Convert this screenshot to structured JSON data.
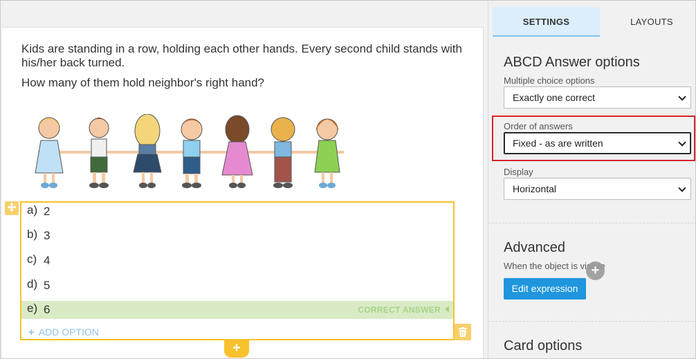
{
  "question": {
    "line1": "Kids are standing in a row, holding each other hands. Every second child stands with his/her back turned.",
    "line2": "How many of them hold neighbor's right hand?"
  },
  "answers": {
    "options": [
      {
        "letter": "a)",
        "value": "2"
      },
      {
        "letter": "b)",
        "value": "3"
      },
      {
        "letter": "c)",
        "value": "4"
      },
      {
        "letter": "d)",
        "value": "5"
      },
      {
        "letter": "e)",
        "value": "6"
      }
    ],
    "correct_label": "CORRECT ANSWER",
    "add_option": "ADD OPTION"
  },
  "tabs": {
    "settings": "SETTINGS",
    "layouts": "LAYOUTS"
  },
  "abcd": {
    "title": "ABCD Answer options",
    "multiple_choice_label": "Multiple choice options",
    "multiple_choice_value": "Exactly one correct",
    "order_label": "Order of answers",
    "order_value": "Fixed - as are written",
    "display_label": "Display",
    "display_value": "Horizontal"
  },
  "advanced": {
    "title": "Advanced",
    "hint": "When the object is visible",
    "edit_button": "Edit expression"
  },
  "card_options": {
    "title": "Card options"
  },
  "colors": {
    "accent": "#1f96dd",
    "answers_border": "#f7c22b",
    "correct_bg": "#d8ebc5",
    "highlight": "#d8232a"
  }
}
